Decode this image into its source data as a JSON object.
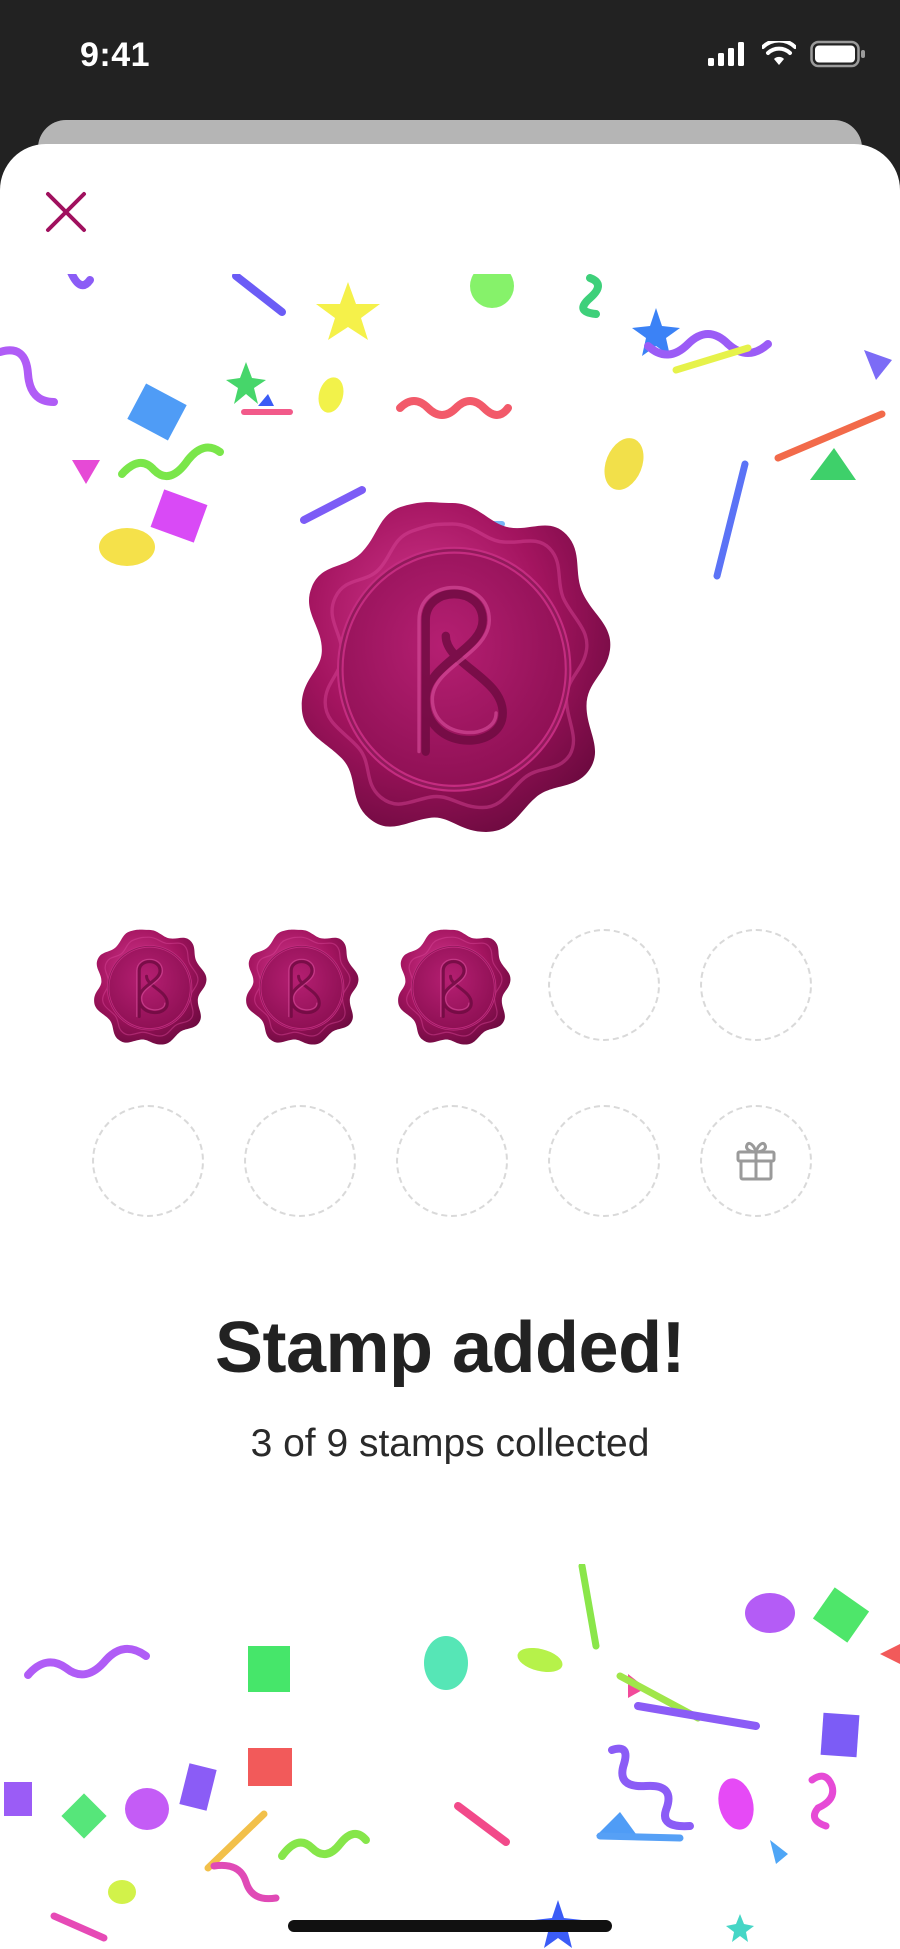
{
  "status_bar": {
    "time": "9:41"
  },
  "modal": {
    "title": "Stamp added!",
    "subtitle": "3 of 9 stamps collected"
  },
  "stamp_card": {
    "collected": 3,
    "total": 9,
    "slots": [
      "stamp",
      "stamp",
      "stamp",
      "empty",
      "empty",
      "empty",
      "empty",
      "empty",
      "empty",
      "reward"
    ]
  },
  "icons": {
    "close": "close-icon",
    "reward": "gift-icon",
    "seal": "wax-seal-icon"
  },
  "colors": {
    "brand_magenta": "#a0105e",
    "seal_light": "#c3277f",
    "seal_dark": "#7d0c4a",
    "title_text": "#222222"
  }
}
